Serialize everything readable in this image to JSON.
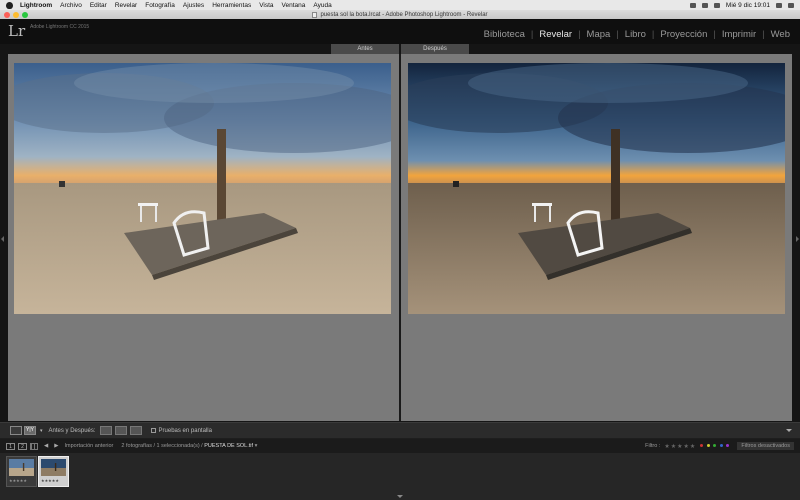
{
  "menubar": {
    "app": "Lightroom",
    "items": [
      "Archivo",
      "Editar",
      "Revelar",
      "Fotografía",
      "Ajustes",
      "Herramientas",
      "Vista",
      "Ventana",
      "Ayuda"
    ],
    "clock": "Mié 9 dic  19:01"
  },
  "window": {
    "title": "puesta sol la bota.lrcat - Adobe Photoshop Lightroom - Revelar"
  },
  "identity": {
    "logo": "Lr",
    "version": "Adobe Lightroom CC 2015"
  },
  "modules": [
    {
      "label": "Biblioteca",
      "active": false
    },
    {
      "label": "Revelar",
      "active": true
    },
    {
      "label": "Mapa",
      "active": false
    },
    {
      "label": "Libro",
      "active": false
    },
    {
      "label": "Proyección",
      "active": false
    },
    {
      "label": "Imprimir",
      "active": false
    },
    {
      "label": "Web",
      "active": false
    }
  ],
  "compare": {
    "before_label": "Antes",
    "after_label": "Después"
  },
  "toolbar": {
    "view_label": "Y|Y",
    "before_after_label": "Antes y Después:",
    "soft_proof_label": "Pruebas en pantalla"
  },
  "filmstrip_bar": {
    "monitor_1": "1",
    "monitor_2": "2",
    "source": "Importación anterior",
    "count": "2 fotografías / 1 seleccionada(s) /",
    "filename": "PUESTA DE SOL.tif",
    "filter_label": "Filtro :",
    "filter_status": "Filtros desactivados"
  },
  "thumbnails": [
    {
      "rating": "★★★★★",
      "selected": false
    },
    {
      "rating": "★★★★★",
      "selected": true
    }
  ],
  "colors": {
    "accent_active": "#e8e8e8",
    "panel_bg": "#7a7a7a"
  }
}
